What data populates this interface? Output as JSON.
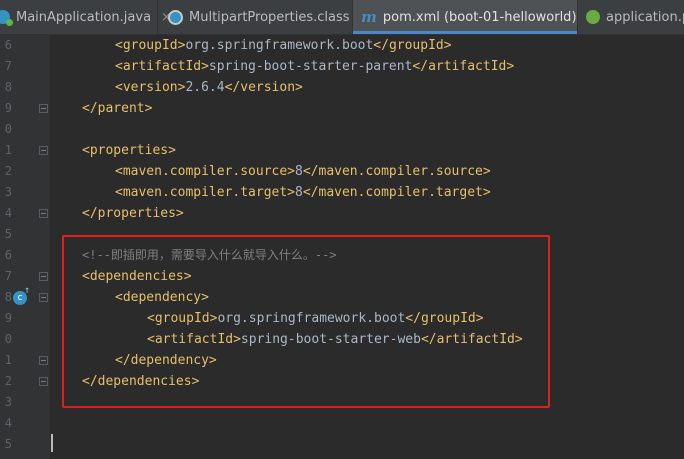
{
  "tabs": [
    {
      "label": "MainApplication.java",
      "close": "×",
      "icon": "java-class-icon"
    },
    {
      "label": "MultipartProperties.class",
      "close": "×",
      "icon": "class-file-icon"
    },
    {
      "label": "pom.xml (boot-01-helloworld)",
      "close": "×",
      "icon": "maven-m-icon",
      "icon_text": "m",
      "active": true
    },
    {
      "label": "application.pr",
      "close": "",
      "icon": "spring-properties-icon"
    }
  ],
  "line_numbers": [
    "6",
    "7",
    "8",
    "9",
    "0",
    "1",
    "2",
    "3",
    "4",
    "5",
    "6",
    "7",
    "8",
    "9",
    "0",
    "1",
    "2",
    "3",
    "4",
    "5"
  ],
  "code": {
    "l06": {
      "open": "<groupId>",
      "value": "org.springframework.boot",
      "close": "</groupId>"
    },
    "l07": {
      "open": "<artifactId>",
      "value": "spring-boot-starter-parent",
      "close": "</artifactId>"
    },
    "l08": {
      "open": "<version>",
      "value": "2.6.4",
      "close": "</version>"
    },
    "l09": {
      "close": "</parent>"
    },
    "l11": {
      "open": "<properties>"
    },
    "l12": {
      "open": "<maven.compiler.source>",
      "value": "8",
      "close": "</maven.compiler.source>"
    },
    "l13": {
      "open": "<maven.compiler.target>",
      "value": "8",
      "close": "</maven.compiler.target>"
    },
    "l14": {
      "close": "</properties>"
    },
    "l16": {
      "comment": "<!--即插即用，需要导入什么就导入什么。-->"
    },
    "l17": {
      "open": "<dependencies>"
    },
    "l18": {
      "open": "<dependency>"
    },
    "l19": {
      "open": "<groupId>",
      "value": "org.springframework.boot",
      "close": "</groupId>"
    },
    "l20": {
      "open": "<artifactId>",
      "value": "spring-boot-starter-web",
      "close": "</artifactId>"
    },
    "l21": {
      "close": "</dependency>"
    },
    "l22": {
      "close": "</dependencies>"
    }
  },
  "gutter_icon_text": "c",
  "gutter_icon_arrow": "↑",
  "colors": {
    "background": "#2b2b2b",
    "tag": "#e8bf6a",
    "text": "#a9b7c6",
    "comment": "#808080",
    "highlight_box": "#e0201c",
    "active_tab_underline": "#4a88c7"
  }
}
